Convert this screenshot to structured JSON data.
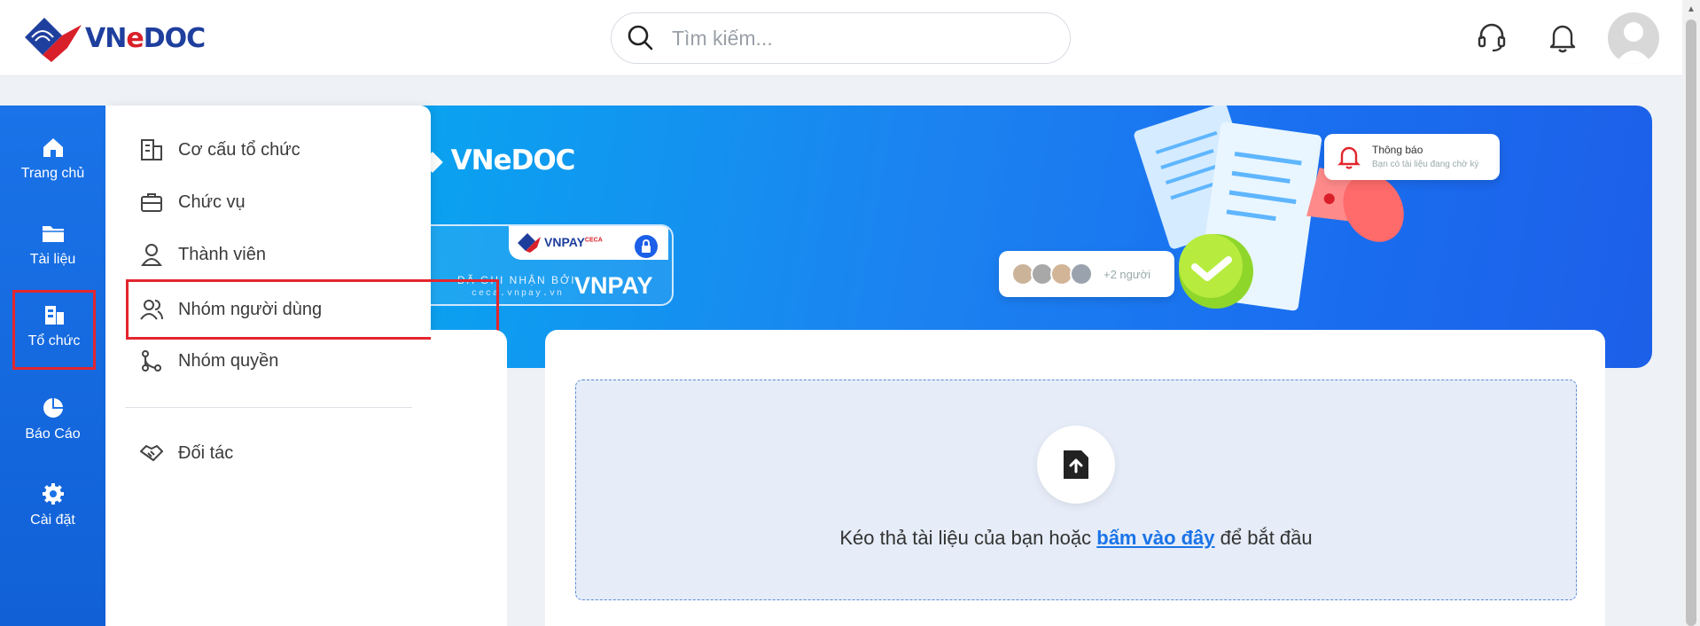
{
  "brand": {
    "name_main": "VN",
    "name_red": "e",
    "name_end": "DOC"
  },
  "search": {
    "placeholder": "Tìm kiếm..."
  },
  "header_icons": [
    "headset-icon",
    "bell-icon",
    "user-avatar"
  ],
  "left_nav": {
    "items": [
      {
        "label": "Trang chủ",
        "icon": "home-icon"
      },
      {
        "label": "Tài liệu",
        "icon": "folder-icon"
      },
      {
        "label": "Tổ chức",
        "icon": "building-icon",
        "active": true
      },
      {
        "label": "Báo Cáo",
        "icon": "pie-chart-icon"
      },
      {
        "label": "Cài đặt",
        "icon": "gear-icon"
      }
    ]
  },
  "submenu": {
    "items": [
      {
        "label": "Cơ cấu tổ chức",
        "icon": "org-structure-icon"
      },
      {
        "label": "Chức vụ",
        "icon": "briefcase-icon"
      },
      {
        "label": "Thành viên",
        "icon": "member-icon"
      },
      {
        "label": "Nhóm người dùng",
        "icon": "user-group-icon",
        "active": true
      },
      {
        "label": "Nhóm quyền",
        "icon": "branch-icon"
      },
      {
        "label": "Đối tác",
        "icon": "handshake-icon"
      }
    ]
  },
  "banner": {
    "logo_text": "VNeDOC",
    "vnpay_logo": "VNPAY",
    "vnpay_sup": "CECA",
    "vnpay_caption": "ĐÃ GHI NHẬN BỞI",
    "vnpay_url": "ceca.vnpay.vn",
    "vnpay_big": "VNPAY",
    "notif_title": "Thông báo",
    "notif_sub": "Bạn có tài liệu đang chờ ký",
    "people_more": "+2 người"
  },
  "dropzone": {
    "text_before": "Kéo thả tài liệu của bạn hoặc ",
    "link": "bấm vào đây",
    "text_after": " để bắt đầu"
  },
  "colors": {
    "primary": "#1a73e8",
    "brand_blue": "#1f3f9e",
    "brand_red": "#d9202a",
    "highlight": "#e3262e"
  }
}
